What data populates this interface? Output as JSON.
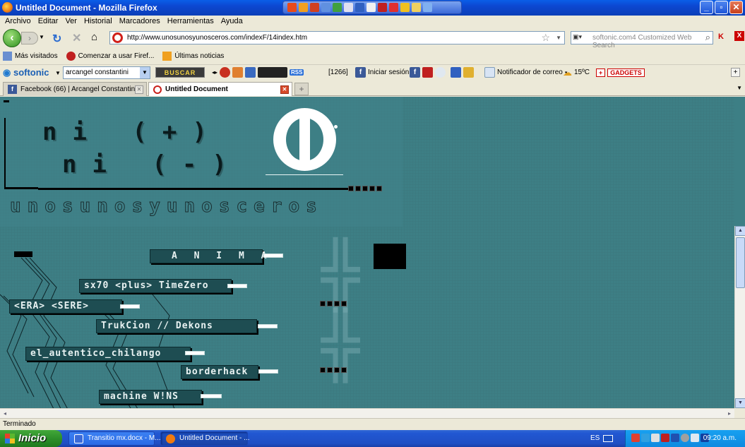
{
  "window": {
    "title": "Untitled Document - Mozilla Firefox"
  },
  "menubar": [
    "Archivo",
    "Editar",
    "Ver",
    "Historial",
    "Marcadores",
    "Herramientas",
    "Ayuda"
  ],
  "nav": {
    "url": "http://www.unosunosyunosceros.com/indexF/14index.htm",
    "search_placeholder": "softonic.com4 Customized Web Search"
  },
  "bookmarks": [
    "Más visitados",
    "Comenzar a usar Firef...",
    "Últimas noticias"
  ],
  "softonic": {
    "logo": "softonic",
    "search_value": "arcangel constantini",
    "buscar_label": "BUSCAR WEB",
    "count": "[1266]",
    "login": "Iniciar sesión",
    "mail": "Notificador de correo",
    "weather": "15ºC",
    "gadgets": "GADGETS"
  },
  "tabs": [
    {
      "label": "Facebook (66) | Arcangel Constantini",
      "active": false
    },
    {
      "label": "Untitled Document",
      "active": true
    }
  ],
  "page": {
    "logo_line1": "ni (+)",
    "logo_line2": "ni (-)",
    "sub_logo": "unosunosyunosceros",
    "menu": [
      {
        "label": "A N I M A"
      },
      {
        "label": "sx70 <plus> TimeZero"
      },
      {
        "label": "<ERA> <SERE>"
      },
      {
        "label": "TrukCion // Dekons"
      },
      {
        "label": "el_autentico_chilango"
      },
      {
        "label": "borderhack"
      },
      {
        "label": "machine W!NS"
      }
    ]
  },
  "status": "Terminado",
  "taskbar": {
    "start": "Inicio",
    "tasks": [
      {
        "label": "Transitio mx.docx - M...",
        "active": false
      },
      {
        "label": "Untitled Document - ...",
        "active": true
      }
    ],
    "lang": "ES",
    "clock": "09:20 a.m."
  }
}
